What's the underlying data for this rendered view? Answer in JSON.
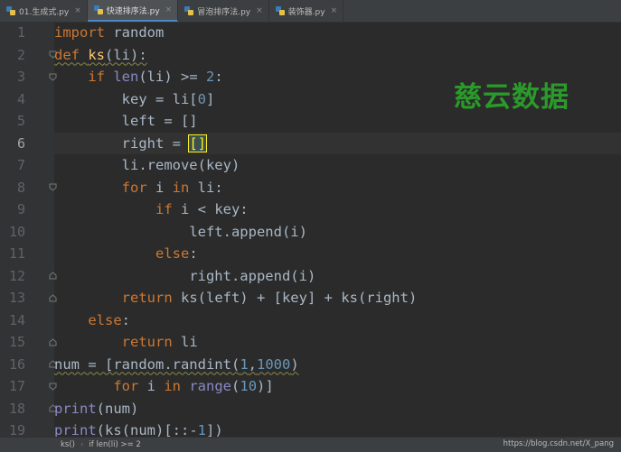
{
  "tabs": [
    {
      "label": "01.生成式.py",
      "active": false
    },
    {
      "label": "快速排序法.py",
      "active": true
    },
    {
      "label": "冒泡排序法.py",
      "active": false
    },
    {
      "label": "装饰器.py",
      "active": false
    }
  ],
  "close_glyph": "×",
  "watermark": "慈云数据",
  "line_numbers": [
    "1",
    "2",
    "3",
    "4",
    "5",
    "6",
    "7",
    "8",
    "9",
    "10",
    "11",
    "12",
    "13",
    "14",
    "15",
    "16",
    "17",
    "18",
    "19"
  ],
  "code": {
    "l1": {
      "kw": "import",
      "rest": " random"
    },
    "l2": {
      "kw": "def",
      "sp": " ",
      "fn": "ks",
      "rest": "(li):"
    },
    "l3": {
      "indent": "    ",
      "kw": "if",
      "sp": " ",
      "bi": "len",
      "mid": "(li) >= ",
      "num": "2",
      "end": ":"
    },
    "l4": {
      "indent": "        ",
      "a": "key = li[",
      "num": "0",
      "b": "]"
    },
    "l5": {
      "indent": "        ",
      "a": "left = []"
    },
    "l6": {
      "indent": "        ",
      "a": "right = ",
      "brk": "[]"
    },
    "l7": {
      "indent": "        ",
      "a": "li.remove(key)"
    },
    "l8": {
      "indent": "        ",
      "kw1": "for",
      "a": " i ",
      "kw2": "in",
      "b": " li:"
    },
    "l9": {
      "indent": "            ",
      "kw": "if",
      "a": " i < key:"
    },
    "l10": {
      "indent": "                ",
      "a": "left.append(i)"
    },
    "l11": {
      "indent": "            ",
      "kw": "else",
      "a": ":"
    },
    "l12": {
      "indent": "                ",
      "a": "right.append(i)"
    },
    "l13": {
      "indent": "        ",
      "kw": "return",
      "a": " ks(left) + [key] + ks(right)"
    },
    "l14": {
      "indent": "    ",
      "kw": "else",
      "a": ":"
    },
    "l15": {
      "indent": "        ",
      "kw": "return",
      "a": " li"
    },
    "l16": {
      "a": "num = [random.randint(",
      "n1": "1",
      "c": ",",
      "n2": "1000",
      "b": ")"
    },
    "l17": {
      "indent": "       ",
      "kw1": "for",
      "a": " i ",
      "kw2": "in",
      "sp": " ",
      "bi": "range",
      "b": "(",
      "num": "10",
      "c": ")]"
    },
    "l18": {
      "bi": "print",
      "a": "(num)"
    },
    "l19": {
      "bi": "print",
      "a": "(ks(num)[::-",
      "num": "1",
      "b": "])"
    }
  },
  "statusbar": {
    "crumb1": "ks()",
    "sep": "›",
    "crumb2": "if len(li) >= 2",
    "credit": "https://blog.csdn.net/X_pang"
  }
}
